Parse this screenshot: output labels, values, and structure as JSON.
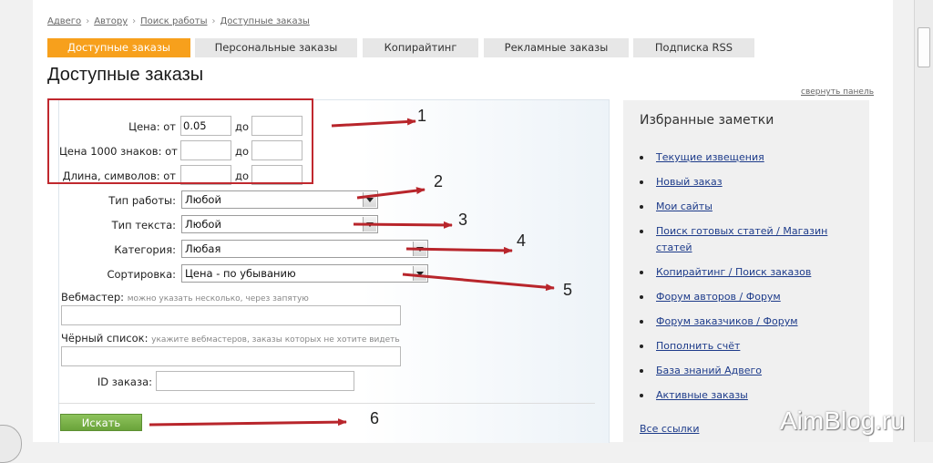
{
  "breadcrumb": [
    "Адвего",
    "Автору",
    "Поиск работы",
    "Доступные заказы"
  ],
  "tabs": [
    "Доступные заказы",
    "Персональные заказы",
    "Копирайтинг",
    "Рекламные заказы",
    "Подписка RSS"
  ],
  "page_title": "Доступные заказы",
  "collapse_link": "свернуть панель",
  "form": {
    "price_label": "Цена: от",
    "price_from": "0.05",
    "price_1000_label": "Цена 1000 знаков: от",
    "length_label": "Длина, символов: от",
    "to_label": "до",
    "work_type_label": "Тип работы:",
    "work_type_value": "Любой",
    "text_type_label": "Тип текста:",
    "text_type_value": "Любой",
    "category_label": "Категория:",
    "category_value": "Любая",
    "sort_label": "Сортировка:",
    "sort_value": "Цена - по убыванию",
    "webmaster_label": "Вебмастер:",
    "webmaster_hint": "можно указать несколько, через запятую",
    "blacklist_label": "Чёрный список:",
    "blacklist_hint": "укажите вебмастеров, заказы которых не хотите видеть",
    "order_id_label": "ID заказа:",
    "search_button": "Искать"
  },
  "annotations": [
    "1",
    "2",
    "3",
    "4",
    "5",
    "6"
  ],
  "sidebar": {
    "title": "Избранные заметки",
    "items": [
      "Текущие извещения",
      "Новый заказ",
      "Мои сайты",
      "Поиск готовых статей / Магазин статей",
      "Копирайтинг / Поиск заказов",
      "Форум авторов / Форум",
      "Форум заказчиков / Форум",
      "Пополнить счёт",
      "База знаний Адвего",
      "Активные заказы"
    ],
    "all_links": "Все ссылки"
  },
  "watermark": "AimBlog.ru",
  "colors": {
    "active_tab": "#f7a01c",
    "button": "#74ad42",
    "annotation": "#c0282e",
    "link": "#1d3b8a"
  }
}
